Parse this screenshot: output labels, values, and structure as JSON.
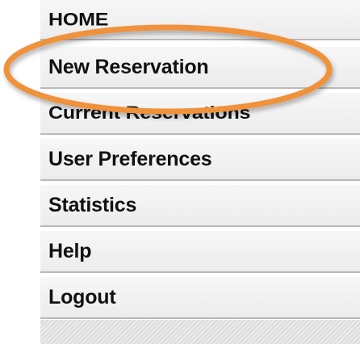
{
  "menu": {
    "items": [
      {
        "label": "HOME"
      },
      {
        "label": "New Reservation"
      },
      {
        "label": "Current Reservations"
      },
      {
        "label": "User Preferences"
      },
      {
        "label": "Statistics"
      },
      {
        "label": "Help"
      },
      {
        "label": "Logout"
      }
    ]
  },
  "annotation": {
    "highlighted_item": "New Reservation",
    "color": "#f0913a"
  },
  "colors": {
    "item_background": "#f1f1f1",
    "divider": "#b9b9b9",
    "text": "#111111"
  }
}
